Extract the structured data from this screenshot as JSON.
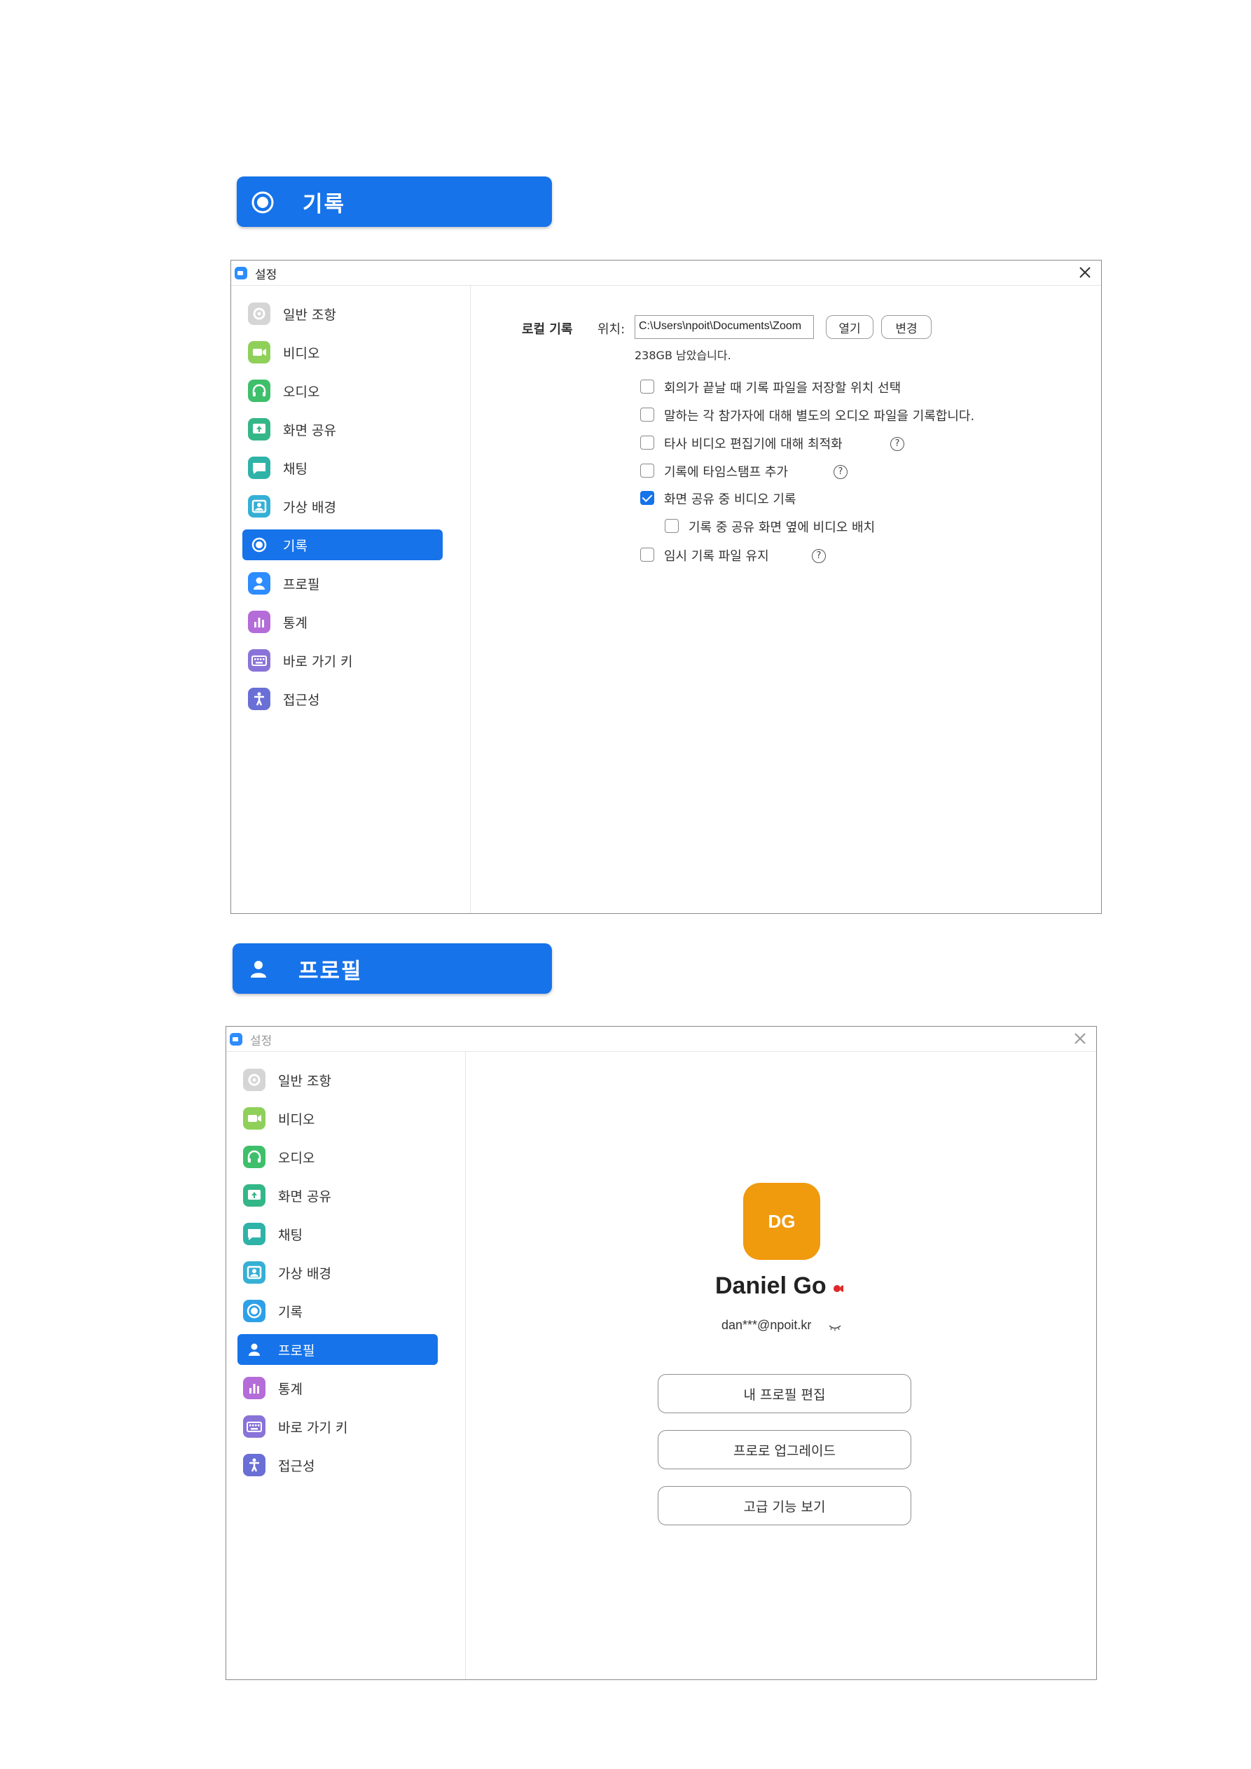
{
  "colors": {
    "accent": "#1673ea",
    "avatar_bg": "#f09a0e"
  },
  "section_recording": {
    "title": "기록",
    "icon": "record-icon"
  },
  "section_profile": {
    "title": "프로필",
    "icon": "user-icon"
  },
  "window": {
    "title": "설정",
    "close_icon": "close-icon"
  },
  "sidebar": {
    "items": [
      {
        "label": "일반 조항",
        "icon": "gear-icon",
        "color": "#d5d5d5"
      },
      {
        "label": "비디오",
        "icon": "video-icon",
        "color": "#8fd05a"
      },
      {
        "label": "오디오",
        "icon": "headphones-icon",
        "color": "#3fbf6b"
      },
      {
        "label": "화면 공유",
        "icon": "share-screen-icon",
        "color": "#34b788"
      },
      {
        "label": "채팅",
        "icon": "chat-icon",
        "color": "#2fb3a8"
      },
      {
        "label": "가상 배경",
        "icon": "background-icon",
        "color": "#35b0d4"
      },
      {
        "label": "기록",
        "icon": "record-icon",
        "color": "#2ea0e8"
      },
      {
        "label": "프로필",
        "icon": "user-icon",
        "color": "#2d8cff"
      },
      {
        "label": "통계",
        "icon": "stats-icon",
        "color": "#b46cd8"
      },
      {
        "label": "바로 가기 키",
        "icon": "keyboard-icon",
        "color": "#8a73d8"
      },
      {
        "label": "접근성",
        "icon": "accessibility-icon",
        "color": "#6a6fd6"
      }
    ]
  },
  "recording": {
    "local_label": "로컬 기록",
    "location_label": "위치:",
    "path": "C:\\Users\\npoit\\Documents\\Zoom",
    "open_button": "열기",
    "change_button": "변경",
    "free_space": "238GB 남았습니다.",
    "options": [
      {
        "label": "회의가 끝날 때 기록 파일을 저장할 위치 선택",
        "checked": false,
        "help": false
      },
      {
        "label": "말하는 각 참가자에 대해 별도의 오디오 파일을 기록합니다.",
        "checked": false,
        "help": false
      },
      {
        "label": "타사 비디오 편집기에 대해 최적화",
        "checked": false,
        "help": true
      },
      {
        "label": "기록에 타임스탬프 추가",
        "checked": false,
        "help": true
      },
      {
        "label": "화면 공유 중 비디오 기록",
        "checked": true,
        "help": false
      },
      {
        "label": "기록 중 공유 화면 옆에 비디오 배치",
        "checked": false,
        "help": false
      },
      {
        "label": "임시 기록 파일 유지",
        "checked": false,
        "help": true
      }
    ],
    "help_glyph": "?"
  },
  "profile": {
    "initials": "DG",
    "name": "Daniel Go",
    "email": "dan***@npoit.kr",
    "status_icon": "recording-dot-icon",
    "email_toggle_icon": "eye-closed-icon",
    "buttons": [
      "내 프로필 편집",
      "프로로 업그레이드",
      "고급 기능 보기"
    ]
  }
}
